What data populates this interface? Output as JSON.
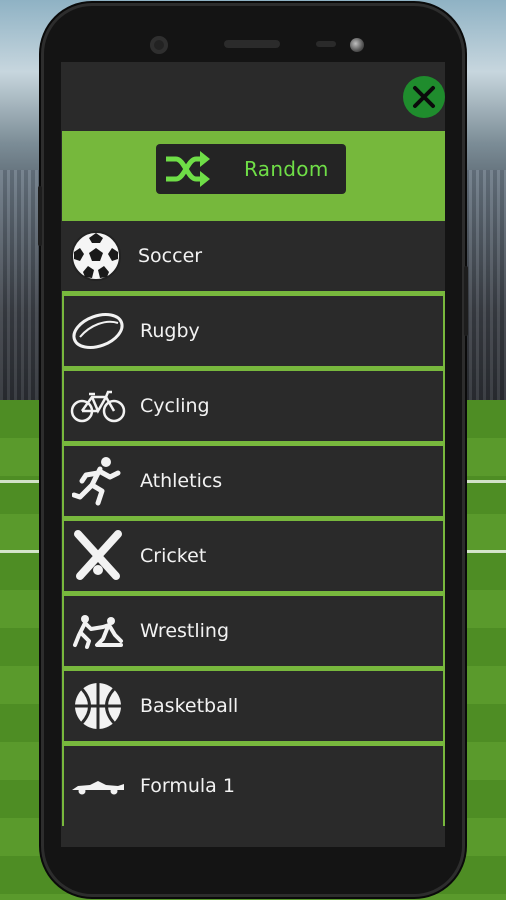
{
  "screen": {
    "close_icon": "close-icon",
    "random": {
      "label": "Random",
      "icon": "shuffle-icon"
    },
    "sports": [
      {
        "label": "Soccer",
        "icon": "soccer-ball-icon"
      },
      {
        "label": "Rugby",
        "icon": "rugby-ball-icon"
      },
      {
        "label": "Cycling",
        "icon": "bicycle-icon"
      },
      {
        "label": "Athletics",
        "icon": "runner-icon"
      },
      {
        "label": "Cricket",
        "icon": "cricket-bats-icon"
      },
      {
        "label": "Wrestling",
        "icon": "wrestlers-icon"
      },
      {
        "label": "Basketball",
        "icon": "basketball-icon"
      },
      {
        "label": "Formula 1",
        "icon": "race-car-icon"
      }
    ]
  },
  "colors": {
    "accent_green": "#76b83c",
    "close_green": "#1f8c2d",
    "random_text": "#6fde47",
    "panel_dark": "#2a2a2a"
  }
}
